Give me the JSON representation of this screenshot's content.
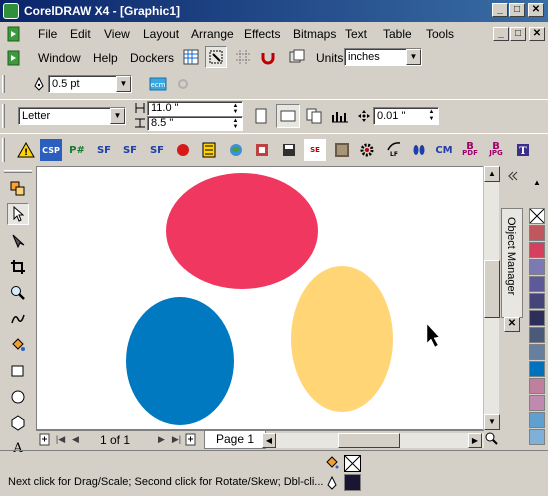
{
  "window": {
    "title": "CorelDRAW X4 - [Graphic1]",
    "minimize_glyph": "_",
    "maximize_glyph": "□",
    "close_glyph": "✕"
  },
  "menu": {
    "items": [
      "File",
      "Edit",
      "View",
      "Layout",
      "Arrange",
      "Effects",
      "Bitmaps",
      "Text",
      "Table",
      "Tools"
    ],
    "items_row2": [
      "Window",
      "Help",
      "Dockers"
    ]
  },
  "standard_toolbar": {
    "units_label": "Units:",
    "units_value": "inches"
  },
  "outline": {
    "width_value": "0.5 pt"
  },
  "property_bar": {
    "paper_type": "Letter",
    "width_value": "11.0 \"",
    "height_value": "8.5 \"",
    "nudge_value": "0.01 \""
  },
  "macro_toolbar": {
    "labels": [
      "CSP",
      "P#",
      "SF",
      "SF",
      "SF",
      "",
      "",
      "",
      "",
      "",
      "",
      "SE",
      "",
      "",
      "LF",
      "CM",
      "PDF",
      "JPG"
    ]
  },
  "page_nav": {
    "page_count": "1 of 1",
    "page_tab": "Page 1"
  },
  "docker": {
    "title": "Object Manager"
  },
  "colors": {
    "red_ellipse": "#f0375f",
    "blue_ellipse": "#0079c1",
    "yellow_ellipse": "#ffd575",
    "palette": [
      "#ffffff",
      "#c0575f",
      "#d4415f",
      "#7c79b5",
      "#5e5a9a",
      "#45457a",
      "#2e2e5a",
      "#4a5a78",
      "#667f9f",
      "#0071bc",
      "#bf7f9f",
      "#c08ab0",
      "#5fa0d0",
      "#7fb0d8"
    ]
  },
  "status": {
    "message": "Next click for Drag/Scale; Second click for Rotate/Skew; Dbl-cli..."
  }
}
